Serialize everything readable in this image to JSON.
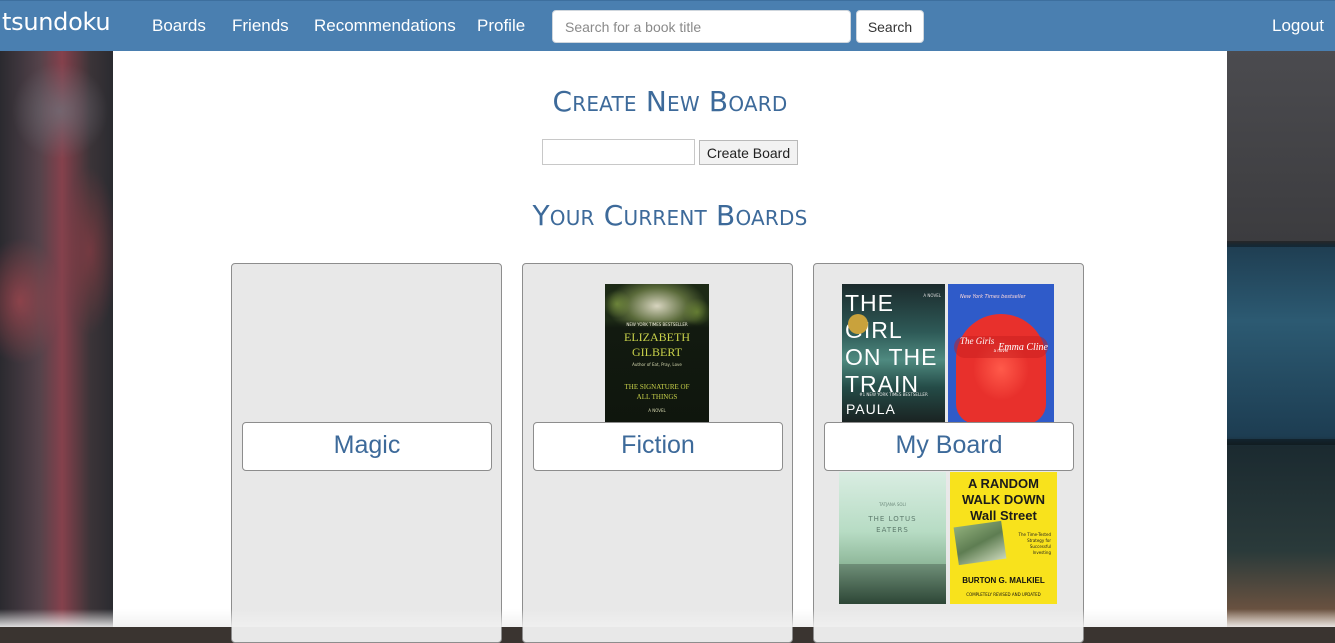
{
  "nav": {
    "brand": "tsundoku",
    "links": [
      "Boards",
      "Friends",
      "Recommendations",
      "Profile"
    ],
    "search_placeholder": "Search for a book title",
    "search_button": "Search",
    "logout": "Logout"
  },
  "create": {
    "title": "Create New Board",
    "button": "Create Board"
  },
  "current": {
    "title": "Your Current Boards"
  },
  "boards": [
    {
      "name": "Magic"
    },
    {
      "name": "Fiction",
      "books": [
        {
          "badge": "NEW YORK TIMES BESTSELLER",
          "author": "ELIZABETH GILBERT",
          "note": "Author of Eat, Pray, Love",
          "title": "THE SIGNATURE OF ALL THINGS",
          "subtitle": "A NOVEL"
        }
      ]
    },
    {
      "name": "My Board",
      "books": [
        {
          "title": "THE GIRL ON THE TRAIN",
          "tag": "A NOVEL",
          "badge": "#1 NEW YORK TIMES BESTSELLER",
          "author": "PAULA"
        },
        {
          "badge": "New York Times bestseller",
          "title": "The Girls",
          "tag": "a novel",
          "author": "Emma Cline"
        },
        {
          "title": "THE LOTUS EATERS",
          "author": "TATJANA SOLI"
        },
        {
          "title": "A RANDOM WALK DOWN Wall Street",
          "tagline": "The Time-Tested Strategy for Successful Investing",
          "author": "BURTON G. MALKIEL",
          "footer": "COMPLETELY REVISED AND UPDATED"
        }
      ]
    }
  ],
  "colors": {
    "navbar": "#4a7fb0",
    "heading": "#3d6a9a",
    "board_bg": "#e8e8e8"
  }
}
